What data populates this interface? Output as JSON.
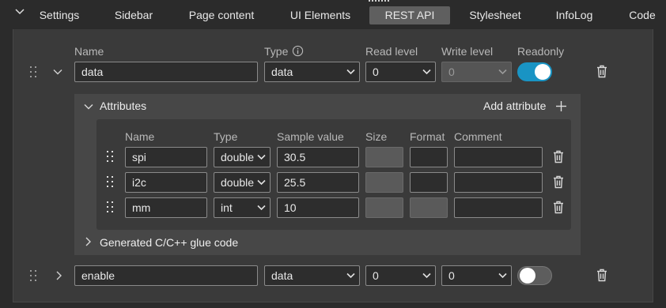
{
  "tabs": [
    {
      "label": "Settings",
      "active": false
    },
    {
      "label": "Sidebar",
      "active": false
    },
    {
      "label": "Page content",
      "active": false
    },
    {
      "label": "UI Elements",
      "active": false
    },
    {
      "label": "REST API",
      "active": true
    },
    {
      "label": "Stylesheet",
      "active": false
    },
    {
      "label": "InfoLog",
      "active": false
    },
    {
      "label": "Code",
      "active": false
    }
  ],
  "columns": {
    "name": "Name",
    "type": "Type",
    "read_level": "Read level",
    "write_level": "Write level",
    "readonly": "Readonly"
  },
  "variables": [
    {
      "name": "data",
      "type": "data",
      "read_level": "0",
      "write_level": "0",
      "readonly": true,
      "expanded": true
    },
    {
      "name": "enable",
      "type": "data",
      "read_level": "0",
      "write_level": "0",
      "readonly": false,
      "expanded": false
    }
  ],
  "attributes_section": {
    "title": "Attributes",
    "add_label": "Add attribute",
    "columns": {
      "name": "Name",
      "type": "Type",
      "sample": "Sample value",
      "size": "Size",
      "format": "Format",
      "comment": "Comment"
    },
    "rows": [
      {
        "name": "spi",
        "type": "double",
        "sample": "30.5",
        "size": "",
        "format": "",
        "comment": ""
      },
      {
        "name": "i2c",
        "type": "double",
        "sample": "25.5",
        "size": "",
        "format": "",
        "comment": ""
      },
      {
        "name": "mm",
        "type": "int",
        "sample": "10",
        "size": "",
        "format": "",
        "comment": ""
      }
    ],
    "glue_code_label": "Generated C/C++ glue code"
  },
  "colors": {
    "accent": "#1994c4",
    "background": "#2b2b2b",
    "panel": "#3a3a3a"
  },
  "icons": [
    "chevron-down-icon",
    "info-icon",
    "drag-handle-icon",
    "trash-icon",
    "plus-icon",
    "chevron-right-icon"
  ]
}
